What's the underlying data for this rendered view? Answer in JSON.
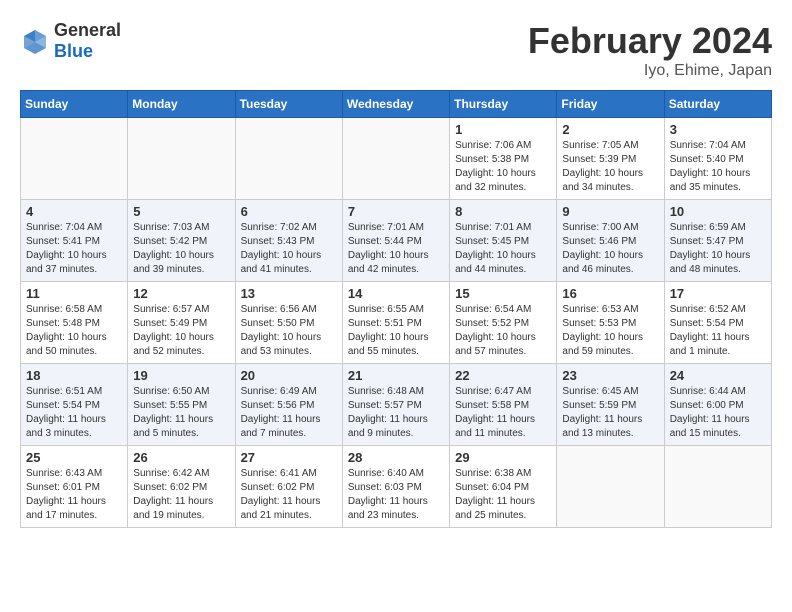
{
  "header": {
    "logo_general": "General",
    "logo_blue": "Blue",
    "month_title": "February 2024",
    "location": "Iyo, Ehime, Japan"
  },
  "weekdays": [
    "Sunday",
    "Monday",
    "Tuesday",
    "Wednesday",
    "Thursday",
    "Friday",
    "Saturday"
  ],
  "weeks": [
    [
      {
        "day": "",
        "sunrise": "",
        "sunset": "",
        "daylight": ""
      },
      {
        "day": "",
        "sunrise": "",
        "sunset": "",
        "daylight": ""
      },
      {
        "day": "",
        "sunrise": "",
        "sunset": "",
        "daylight": ""
      },
      {
        "day": "",
        "sunrise": "",
        "sunset": "",
        "daylight": ""
      },
      {
        "day": "1",
        "sunrise": "Sunrise: 7:06 AM",
        "sunset": "Sunset: 5:38 PM",
        "daylight": "Daylight: 10 hours and 32 minutes."
      },
      {
        "day": "2",
        "sunrise": "Sunrise: 7:05 AM",
        "sunset": "Sunset: 5:39 PM",
        "daylight": "Daylight: 10 hours and 34 minutes."
      },
      {
        "day": "3",
        "sunrise": "Sunrise: 7:04 AM",
        "sunset": "Sunset: 5:40 PM",
        "daylight": "Daylight: 10 hours and 35 minutes."
      }
    ],
    [
      {
        "day": "4",
        "sunrise": "Sunrise: 7:04 AM",
        "sunset": "Sunset: 5:41 PM",
        "daylight": "Daylight: 10 hours and 37 minutes."
      },
      {
        "day": "5",
        "sunrise": "Sunrise: 7:03 AM",
        "sunset": "Sunset: 5:42 PM",
        "daylight": "Daylight: 10 hours and 39 minutes."
      },
      {
        "day": "6",
        "sunrise": "Sunrise: 7:02 AM",
        "sunset": "Sunset: 5:43 PM",
        "daylight": "Daylight: 10 hours and 41 minutes."
      },
      {
        "day": "7",
        "sunrise": "Sunrise: 7:01 AM",
        "sunset": "Sunset: 5:44 PM",
        "daylight": "Daylight: 10 hours and 42 minutes."
      },
      {
        "day": "8",
        "sunrise": "Sunrise: 7:01 AM",
        "sunset": "Sunset: 5:45 PM",
        "daylight": "Daylight: 10 hours and 44 minutes."
      },
      {
        "day": "9",
        "sunrise": "Sunrise: 7:00 AM",
        "sunset": "Sunset: 5:46 PM",
        "daylight": "Daylight: 10 hours and 46 minutes."
      },
      {
        "day": "10",
        "sunrise": "Sunrise: 6:59 AM",
        "sunset": "Sunset: 5:47 PM",
        "daylight": "Daylight: 10 hours and 48 minutes."
      }
    ],
    [
      {
        "day": "11",
        "sunrise": "Sunrise: 6:58 AM",
        "sunset": "Sunset: 5:48 PM",
        "daylight": "Daylight: 10 hours and 50 minutes."
      },
      {
        "day": "12",
        "sunrise": "Sunrise: 6:57 AM",
        "sunset": "Sunset: 5:49 PM",
        "daylight": "Daylight: 10 hours and 52 minutes."
      },
      {
        "day": "13",
        "sunrise": "Sunrise: 6:56 AM",
        "sunset": "Sunset: 5:50 PM",
        "daylight": "Daylight: 10 hours and 53 minutes."
      },
      {
        "day": "14",
        "sunrise": "Sunrise: 6:55 AM",
        "sunset": "Sunset: 5:51 PM",
        "daylight": "Daylight: 10 hours and 55 minutes."
      },
      {
        "day": "15",
        "sunrise": "Sunrise: 6:54 AM",
        "sunset": "Sunset: 5:52 PM",
        "daylight": "Daylight: 10 hours and 57 minutes."
      },
      {
        "day": "16",
        "sunrise": "Sunrise: 6:53 AM",
        "sunset": "Sunset: 5:53 PM",
        "daylight": "Daylight: 10 hours and 59 minutes."
      },
      {
        "day": "17",
        "sunrise": "Sunrise: 6:52 AM",
        "sunset": "Sunset: 5:54 PM",
        "daylight": "Daylight: 11 hours and 1 minute."
      }
    ],
    [
      {
        "day": "18",
        "sunrise": "Sunrise: 6:51 AM",
        "sunset": "Sunset: 5:54 PM",
        "daylight": "Daylight: 11 hours and 3 minutes."
      },
      {
        "day": "19",
        "sunrise": "Sunrise: 6:50 AM",
        "sunset": "Sunset: 5:55 PM",
        "daylight": "Daylight: 11 hours and 5 minutes."
      },
      {
        "day": "20",
        "sunrise": "Sunrise: 6:49 AM",
        "sunset": "Sunset: 5:56 PM",
        "daylight": "Daylight: 11 hours and 7 minutes."
      },
      {
        "day": "21",
        "sunrise": "Sunrise: 6:48 AM",
        "sunset": "Sunset: 5:57 PM",
        "daylight": "Daylight: 11 hours and 9 minutes."
      },
      {
        "day": "22",
        "sunrise": "Sunrise: 6:47 AM",
        "sunset": "Sunset: 5:58 PM",
        "daylight": "Daylight: 11 hours and 11 minutes."
      },
      {
        "day": "23",
        "sunrise": "Sunrise: 6:45 AM",
        "sunset": "Sunset: 5:59 PM",
        "daylight": "Daylight: 11 hours and 13 minutes."
      },
      {
        "day": "24",
        "sunrise": "Sunrise: 6:44 AM",
        "sunset": "Sunset: 6:00 PM",
        "daylight": "Daylight: 11 hours and 15 minutes."
      }
    ],
    [
      {
        "day": "25",
        "sunrise": "Sunrise: 6:43 AM",
        "sunset": "Sunset: 6:01 PM",
        "daylight": "Daylight: 11 hours and 17 minutes."
      },
      {
        "day": "26",
        "sunrise": "Sunrise: 6:42 AM",
        "sunset": "Sunset: 6:02 PM",
        "daylight": "Daylight: 11 hours and 19 minutes."
      },
      {
        "day": "27",
        "sunrise": "Sunrise: 6:41 AM",
        "sunset": "Sunset: 6:02 PM",
        "daylight": "Daylight: 11 hours and 21 minutes."
      },
      {
        "day": "28",
        "sunrise": "Sunrise: 6:40 AM",
        "sunset": "Sunset: 6:03 PM",
        "daylight": "Daylight: 11 hours and 23 minutes."
      },
      {
        "day": "29",
        "sunrise": "Sunrise: 6:38 AM",
        "sunset": "Sunset: 6:04 PM",
        "daylight": "Daylight: 11 hours and 25 minutes."
      },
      {
        "day": "",
        "sunrise": "",
        "sunset": "",
        "daylight": ""
      },
      {
        "day": "",
        "sunrise": "",
        "sunset": "",
        "daylight": ""
      }
    ]
  ]
}
